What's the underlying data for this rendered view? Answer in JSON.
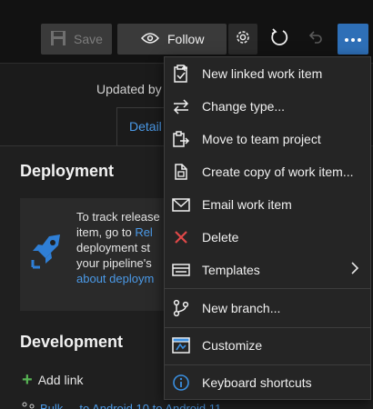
{
  "toolbar": {
    "save_label": "Save",
    "follow_label": "Follow"
  },
  "header": {
    "updated_text": "Updated by",
    "tab_label": "Detail"
  },
  "deployment": {
    "title": "Deployment",
    "line1": "To track release",
    "line2": "item, go to ",
    "line2_link": "Rel",
    "line3": "deployment st",
    "line4": "your pipeline's",
    "line5_link": "about deploym"
  },
  "development": {
    "title": "Development",
    "add_link_label": "Add link",
    "partial_link": "Bulk ... to Android 10 to Android 11"
  },
  "menu": {
    "items": [
      {
        "label": "New linked work item",
        "icon": "clipboard-icon"
      },
      {
        "label": "Change type...",
        "icon": "swap-icon"
      },
      {
        "label": "Move to team project",
        "icon": "move-icon"
      },
      {
        "label": "Create copy of work item...",
        "icon": "copy-icon"
      },
      {
        "label": "Email work item",
        "icon": "mail-icon"
      },
      {
        "label": "Delete",
        "icon": "x-icon"
      },
      {
        "label": "Templates",
        "icon": "template-icon"
      },
      {
        "label": "New branch...",
        "icon": "branch-icon"
      },
      {
        "label": "Customize",
        "icon": "customize-icon"
      },
      {
        "label": "Keyboard shortcuts",
        "icon": "info-icon"
      }
    ]
  },
  "colors": {
    "accent": "#2e6fb7",
    "link": "#4b9ae8",
    "delete_red": "#e04848",
    "info_blue": "#3a8fe0"
  }
}
